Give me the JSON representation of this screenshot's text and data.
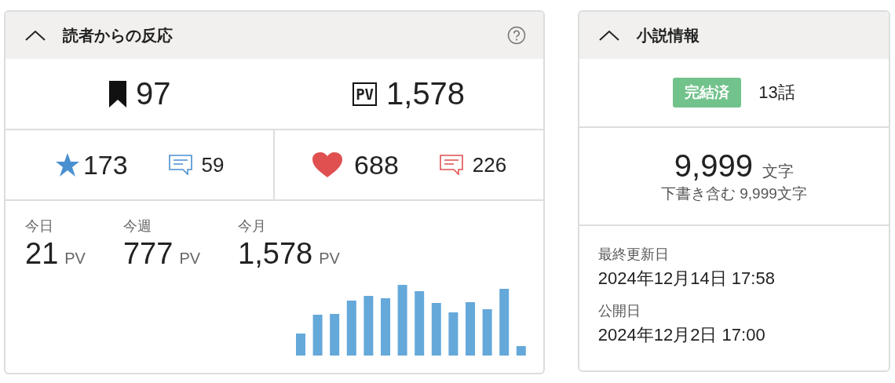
{
  "reactions": {
    "title": "読者からの反応",
    "expanded": true,
    "bookmarks": "97",
    "pv_mark": "PV",
    "pv_total": "1,578",
    "stats": [
      {
        "kind": "star",
        "count": "173",
        "comments": "59",
        "color": "#4a90d0"
      },
      {
        "kind": "heart",
        "count": "688",
        "comments": "226",
        "color": "#e05050"
      }
    ],
    "periods": [
      {
        "label": "今日",
        "value": "21",
        "unit": "PV"
      },
      {
        "label": "今週",
        "value": "777",
        "unit": "PV"
      },
      {
        "label": "今月",
        "value": "1,578",
        "unit": "PV"
      }
    ]
  },
  "novel": {
    "title": "小説情報",
    "expanded": true,
    "status": "完結済",
    "episodes": "13話",
    "chars": "9,999",
    "chars_unit": "文字",
    "draft_note": "下書き含む 9,999文字",
    "dates": [
      {
        "label": "最終更新日",
        "value": "2024年12月14日 17:58"
      },
      {
        "label": "公開日",
        "value": "2024年12月2日 17:00"
      }
    ]
  }
}
